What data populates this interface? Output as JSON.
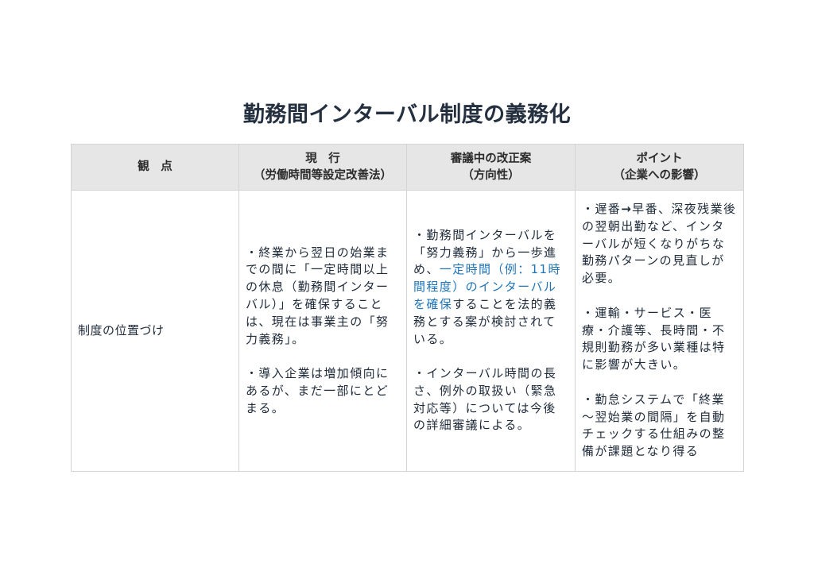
{
  "title": "勤務間インターバル制度の義務化",
  "table": {
    "headers": [
      {
        "line1": "観　点",
        "line2": ""
      },
      {
        "line1": "現　行",
        "line2": "（労働時間等設定改善法）"
      },
      {
        "line1": "審議中の改正案",
        "line2": "（方向性）"
      },
      {
        "line1": "ポイント",
        "line2": "（企業への影響）"
      }
    ],
    "row": {
      "label": "制度の位置づけ",
      "current": [
        "・終業から翌日の始業までの間に「一定時間以上の休息（勤務間インターバル）」を確保することは、現在は事業主の「努力義務」。",
        "・導入企業は増加傾向にあるが、まだ一部にとどまる。"
      ],
      "revision": {
        "p1_before": "・勤務間インターバルを「努力義務」から一歩進め、",
        "p1_highlight": "一定時間（例：11時間程度）のインターバルを確保",
        "p1_after": "することを法的義務とする案が検討されている。",
        "p2": "・インターバル時間の長さ、例外の取扱い（緊急対応等）については今後の詳細審議による。"
      },
      "points": {
        "p1_a": "・遅番",
        "p1_arrow": "→",
        "p1_b": "早番、深夜残業後の翌朝出勤など、インターバルが短くなりがちな勤務パターンの見直しが必要。",
        "p2": "・運輸・サービス・医療・介護等、長時間・不規則勤務が多い業種は特に影響が大きい。",
        "p3": "・勤怠システムで「終業～翌始業の間隔」を自動チェックする仕組みの整備が課題となり得る"
      }
    }
  },
  "colors": {
    "highlight": "#1f75b8",
    "header_bg": "#e6e6e6",
    "text": "#1e2a3a"
  }
}
